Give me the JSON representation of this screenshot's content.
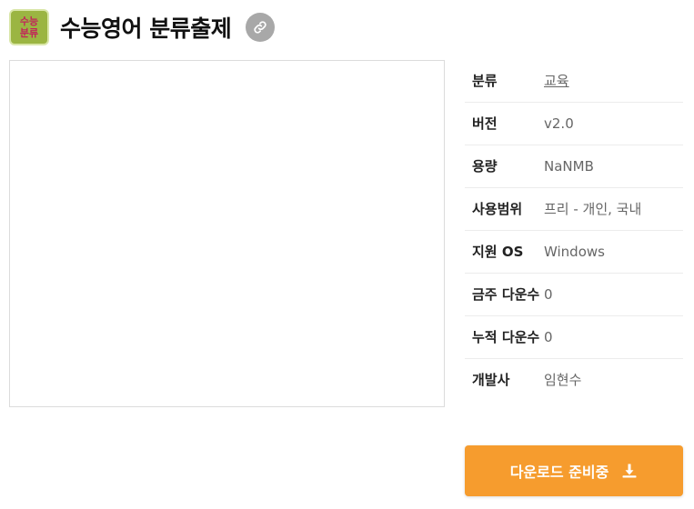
{
  "header": {
    "logo_text": [
      "수능",
      "분류"
    ],
    "title": "수능영어 분류출제",
    "link_icon": "link-icon"
  },
  "info": {
    "rows": [
      {
        "label": "분류",
        "value": "교육",
        "link": true
      },
      {
        "label": "버전",
        "value": "v2.0"
      },
      {
        "label": "용량",
        "value": "NaNMB"
      },
      {
        "label": "사용범위",
        "value": "프리 - 개인, 국내"
      },
      {
        "label": "지원 OS",
        "value": "Windows"
      },
      {
        "label": "금주 다운수",
        "value": "0"
      },
      {
        "label": "누적 다운수",
        "value": "0"
      },
      {
        "label": "개발사",
        "value": "임현수"
      }
    ]
  },
  "download": {
    "label": "다운로드 준비중",
    "icon": "download-icon"
  },
  "colors": {
    "accent": "#f69c2e",
    "link_button": "#a8a8a8",
    "logo_bg": "#9bb542"
  }
}
